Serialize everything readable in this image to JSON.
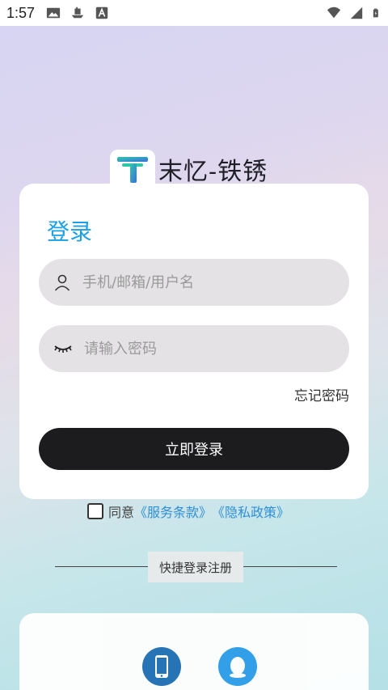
{
  "status_bar": {
    "time": "1:57",
    "icons": [
      "image-icon",
      "ship-icon",
      "font-a-icon",
      "wifi-icon",
      "signal-icon",
      "battery-icon"
    ]
  },
  "brand": {
    "name": "末忆-铁锈",
    "logo_letter": "T",
    "logo_colors": [
      "#2ec8a8",
      "#3a6fe0"
    ]
  },
  "login": {
    "title": "登录",
    "username_placeholder": "手机/邮箱/用户名",
    "password_placeholder": "请输入密码",
    "forgot_label": "忘记密码",
    "submit_label": "立即登录"
  },
  "agreement": {
    "prefix": "同意",
    "terms_link": "《服务条款》",
    "privacy_link": "《隐私政策》",
    "checked": false
  },
  "quick_login": {
    "label": "快捷登录注册",
    "options": [
      "phone-icon",
      "qq-icon"
    ]
  },
  "colors": {
    "accent": "#1aa0e4",
    "link": "#2e8fd6",
    "button": "#1c1c1e",
    "field_bg": "#e4e2e4"
  }
}
